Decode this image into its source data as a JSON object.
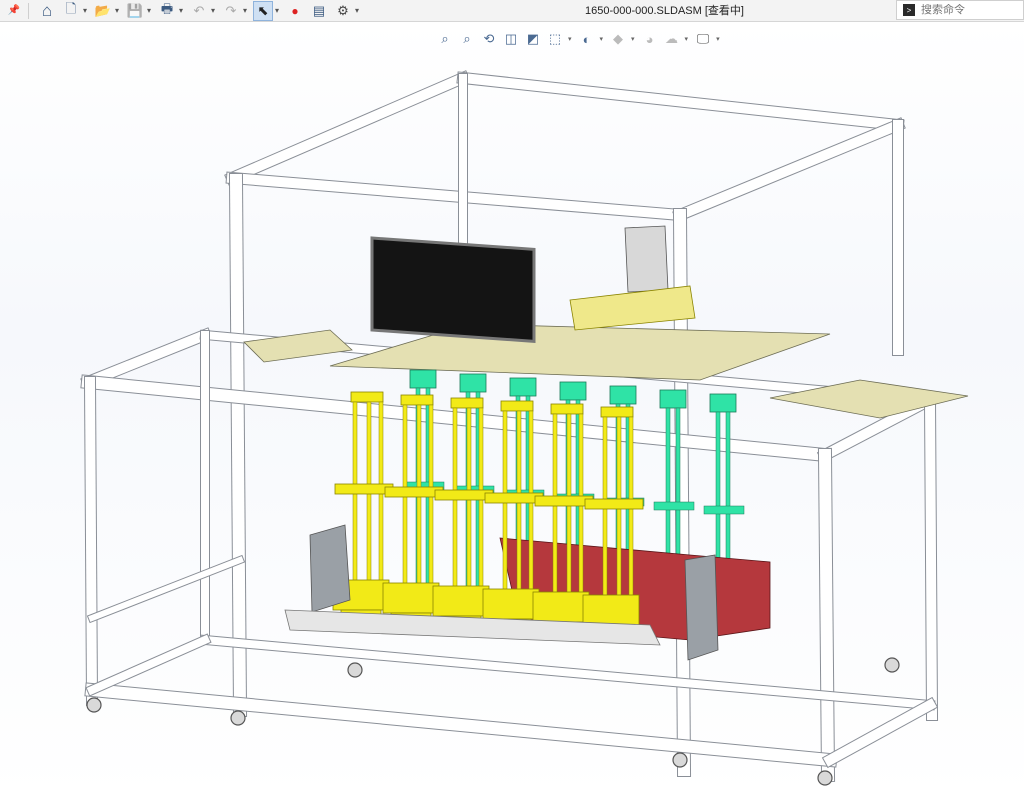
{
  "toolbar": {
    "pin": "📌",
    "home": "⌂",
    "new": "🗋",
    "open": "📂",
    "save": "💾",
    "print": "🖶",
    "undo": "↶",
    "redo": "↷",
    "select": "⬉",
    "rebuild": "●",
    "file_props": "▤",
    "options": "⚙",
    "caret": "▾"
  },
  "document": {
    "title": "1650-000-000.SLDASM [查看中]"
  },
  "search": {
    "placeholder": "搜索命令",
    "icon_text": ">"
  },
  "hud": {
    "zoom_fit": "⌕",
    "zoom_area": "⌕",
    "previous_view": "⟲",
    "section_view": "◫",
    "dynamic_annotation": "◩",
    "view_orientation": "⬚",
    "display_style": "◐",
    "hide_show": "◆",
    "edit_appearance": "◕",
    "apply_scene": "☁",
    "view_settings": "🖵",
    "caret": "▾"
  },
  "colors": {
    "frame": "#ffffff",
    "frame_edge": "#8a8f97",
    "yellow_parts": "#f2ea17",
    "green_parts": "#2fe3a6",
    "plate": "#e4e0b2",
    "red_box": "#b5383d",
    "monitor": "#141414",
    "gray_parts": "#9aa0a6"
  }
}
